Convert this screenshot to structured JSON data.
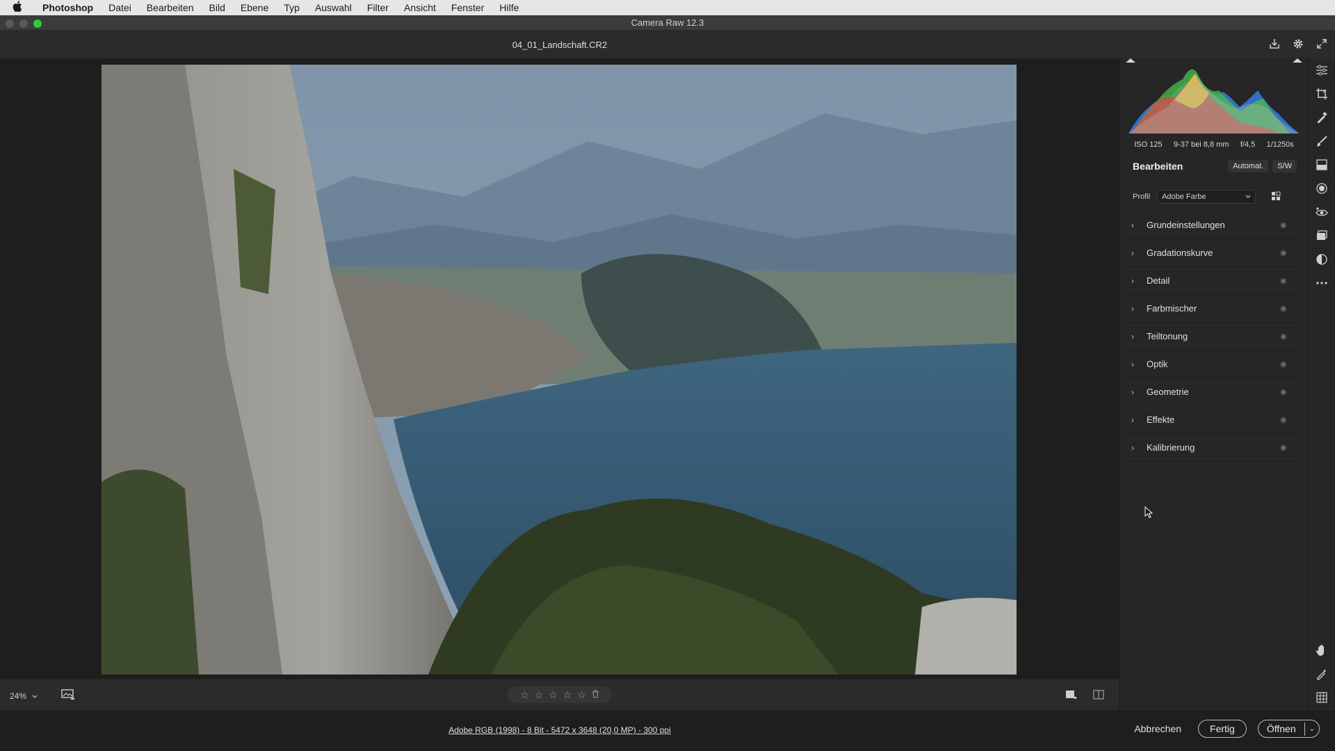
{
  "menubar": {
    "apple": "",
    "items": [
      "Photoshop",
      "Datei",
      "Bearbeiten",
      "Bild",
      "Ebene",
      "Typ",
      "Auswahl",
      "Filter",
      "Ansicht",
      "Fenster",
      "Hilfe"
    ]
  },
  "window": {
    "title": "Camera Raw 12.3"
  },
  "file": {
    "name": "04_01_Landschaft.CR2"
  },
  "exif": {
    "iso": "ISO 125",
    "lens": "9-37 bei 8,8 mm",
    "aperture": "f/4,5",
    "shutter": "1/1250s"
  },
  "edit": {
    "title": "Bearbeiten",
    "auto": "Automat.",
    "bw": "S/W"
  },
  "profile": {
    "label": "Profil",
    "value": "Adobe Farbe"
  },
  "sections": [
    "Grundeinstellungen",
    "Gradationskurve",
    "Detail",
    "Farbmischer",
    "Teiltonung",
    "Optik",
    "Geometrie",
    "Effekte",
    "Kalibrierung"
  ],
  "bottombar": {
    "zoom": "24%"
  },
  "footer": {
    "info": "Adobe RGB (1998) - 8 Bit - 5472 x 3648 (20,0 MP) - 300 ppi",
    "cancel": "Abbrechen",
    "done": "Fertig",
    "open": "Öffnen"
  },
  "colors": {
    "accent_green": "#2fc93f",
    "panel_bg": "#262626"
  }
}
